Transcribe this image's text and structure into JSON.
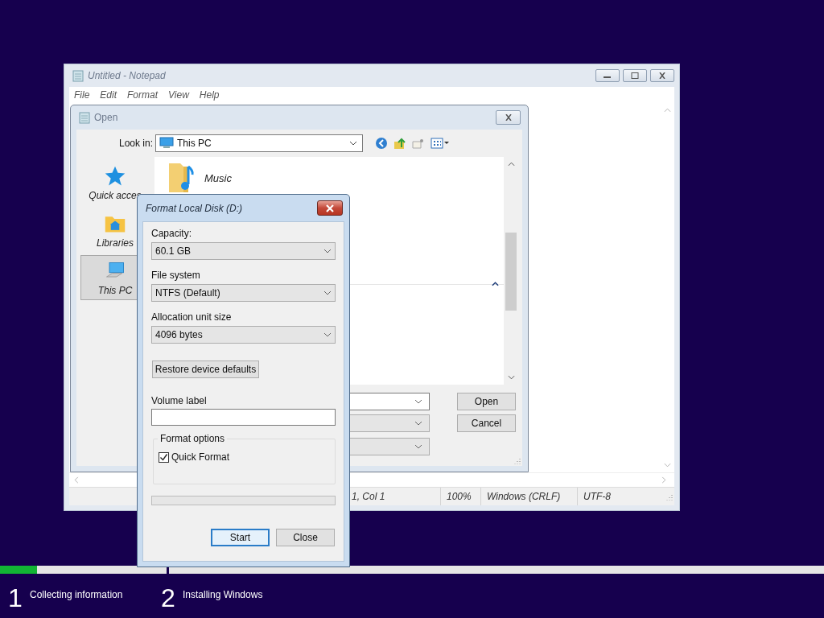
{
  "notepad": {
    "title": "Untitled - Notepad",
    "menu": [
      "File",
      "Edit",
      "Format",
      "View",
      "Help"
    ],
    "status_bar": [
      "1, Col 1",
      "100%",
      "Windows (CRLF)",
      "UTF-8"
    ]
  },
  "open_dialog": {
    "title": "Open",
    "look_in_label": "Look in:",
    "look_in_value": "This PC",
    "places": [
      {
        "label": "Quick acces",
        "kind": "star",
        "selected": false
      },
      {
        "label": "Libraries",
        "kind": "libraries",
        "selected": false
      },
      {
        "label": "This PC",
        "kind": "pc",
        "selected": true
      }
    ],
    "files": [
      {
        "name": "Music"
      }
    ],
    "buttons": [
      "Open",
      "Cancel"
    ]
  },
  "format_dialog": {
    "title": "Format Local Disk (D:)",
    "fields": [
      {
        "label": "Capacity:",
        "value": "60.1 GB"
      },
      {
        "label": "File system",
        "value": "NTFS (Default)"
      },
      {
        "label": "Allocation unit size",
        "value": "4096 bytes"
      }
    ],
    "restore_button": "Restore device defaults",
    "volume_label": "Volume label",
    "format_options": {
      "title": "Format options",
      "options": [
        {
          "label": "Quick Format",
          "checked": true
        }
      ]
    },
    "progress": {
      "level": 0
    },
    "buttons": [
      {
        "label": "Start",
        "default": true
      },
      {
        "label": "Close",
        "default": false
      }
    ]
  },
  "setup_steps": [
    {
      "number": "1",
      "label": "Collecting information",
      "level": 0.22
    },
    {
      "number": "2",
      "label": "Installing Windows",
      "level": 0
    }
  ]
}
